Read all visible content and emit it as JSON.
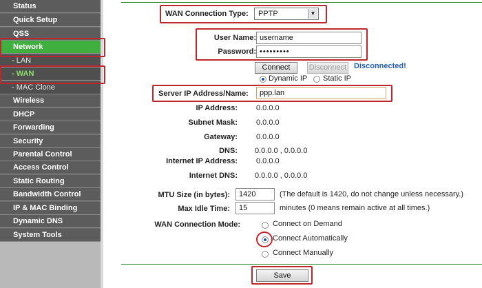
{
  "sidebar": {
    "items": [
      {
        "label": "Status"
      },
      {
        "label": "Quick Setup"
      },
      {
        "label": "QSS"
      },
      {
        "label": "Network"
      },
      {
        "label": "- LAN"
      },
      {
        "label": "- WAN"
      },
      {
        "label": "- MAC Clone"
      },
      {
        "label": "Wireless"
      },
      {
        "label": "DHCP"
      },
      {
        "label": "Forwarding"
      },
      {
        "label": "Security"
      },
      {
        "label": "Parental Control"
      },
      {
        "label": "Access Control"
      },
      {
        "label": "Static Routing"
      },
      {
        "label": "Bandwidth Control"
      },
      {
        "label": "IP & MAC Binding"
      },
      {
        "label": "Dynamic DNS"
      },
      {
        "label": "System Tools"
      }
    ]
  },
  "form": {
    "wan_type_label": "WAN Connection Type:",
    "wan_type_value": "PPTP",
    "username_label": "User Name:",
    "username_value": "username",
    "password_label": "Password:",
    "password_value": "•••••••••",
    "connect_label": "Connect",
    "disconnect_label": "Disconnect",
    "status_text": "Disconnected!",
    "dynamic_ip_label": "Dynamic IP",
    "static_ip_label": "Static IP",
    "server_label": "Server IP Address/Name:",
    "server_value": "ppp.lan",
    "ip_label": "IP Address:",
    "ip_value": "0.0.0.0",
    "subnet_label": "Subnet Mask:",
    "subnet_value": "0.0.0.0",
    "gateway_label": "Gateway:",
    "gateway_value": "0.0.0.0",
    "dns_label": "DNS:",
    "dns_value": "0.0.0.0 , 0.0.0.0",
    "inet_ip_label": "Internet IP Address:",
    "inet_ip_value": "0.0.0.0",
    "inet_dns_label": "Internet DNS:",
    "inet_dns_value": "0.0.0.0 , 0.0.0.0",
    "mtu_label": "MTU Size (in bytes):",
    "mtu_value": "1420",
    "mtu_hint": "(The default is 1420, do not change unless necessary.)",
    "idle_label": "Max Idle Time:",
    "idle_value": "15",
    "idle_hint": "minutes (0 means remain active at all times.)",
    "mode_label": "WAN Connection Mode:",
    "mode_demand": "Connect on Demand",
    "mode_auto": "Connect Automatically",
    "mode_manual": "Connect Manually",
    "save_label": "Save"
  },
  "colors": {
    "accent_green": "#3fb03f",
    "highlight_red": "#c0272d",
    "status_blue": "#1f5fb8"
  }
}
